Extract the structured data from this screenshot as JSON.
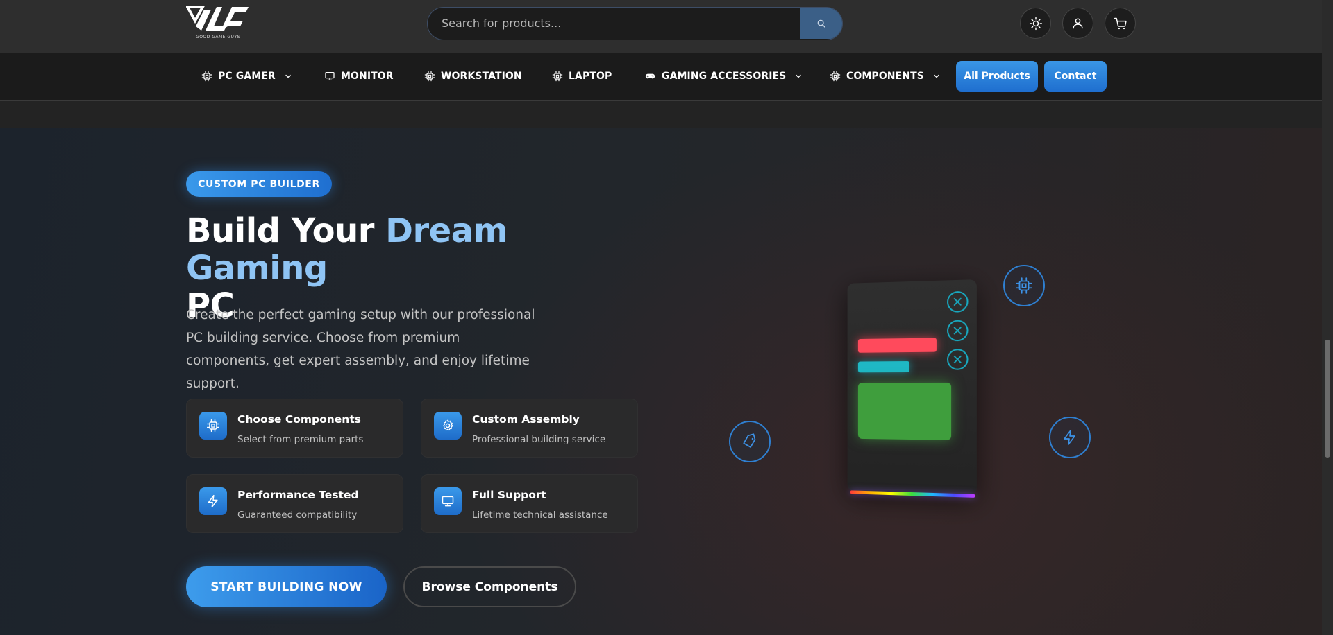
{
  "header": {
    "logo_text": "GOOD GAME GUYS",
    "search": {
      "placeholder": "Search for products..."
    },
    "icons": [
      "sun-icon",
      "user-icon",
      "cart-icon"
    ]
  },
  "nav": {
    "items": [
      {
        "label": "PC GAMER",
        "icon": "chip-icon",
        "dropdown": true
      },
      {
        "label": "MONITOR",
        "icon": "monitor-icon",
        "dropdown": false
      },
      {
        "label": "WORKSTATION",
        "icon": "chip-icon",
        "dropdown": false
      },
      {
        "label": "LAPTOP",
        "icon": "chip-icon",
        "dropdown": false
      },
      {
        "label": "GAMING ACCESSORIES",
        "icon": "gamepad-icon",
        "dropdown": true
      },
      {
        "label": "COMPONENTS",
        "icon": "chip-icon",
        "dropdown": true
      }
    ],
    "all_products": "All Products",
    "contact": "Contact"
  },
  "hero": {
    "badge": "CUSTOM PC BUILDER",
    "title_part1": "Build Your ",
    "title_highlight": "Dream Gaming",
    "title_part2": "PC",
    "description": "Create the perfect gaming setup with our professional PC building service. Choose from premium components, get expert assembly, and enjoy lifetime support.",
    "features": [
      {
        "title": "Choose Components",
        "subtitle": "Select from premium parts",
        "icon": "chip-icon"
      },
      {
        "title": "Custom Assembly",
        "subtitle": "Professional building service",
        "icon": "gear-icon"
      },
      {
        "title": "Performance Tested",
        "subtitle": "Guaranteed compatibility",
        "icon": "lightning-icon"
      },
      {
        "title": "Full Support",
        "subtitle": "Lifetime technical assistance",
        "icon": "monitor-icon"
      }
    ],
    "cta_primary": "START BUILDING NOW",
    "cta_secondary": "Browse Components"
  },
  "colors": {
    "accent": "#2f86e0",
    "accent_light": "#8fc4f4",
    "header_bg": "#2e2e2e",
    "nav_bg": "#1b1b1b",
    "card_bg": "#2a2a2b"
  }
}
